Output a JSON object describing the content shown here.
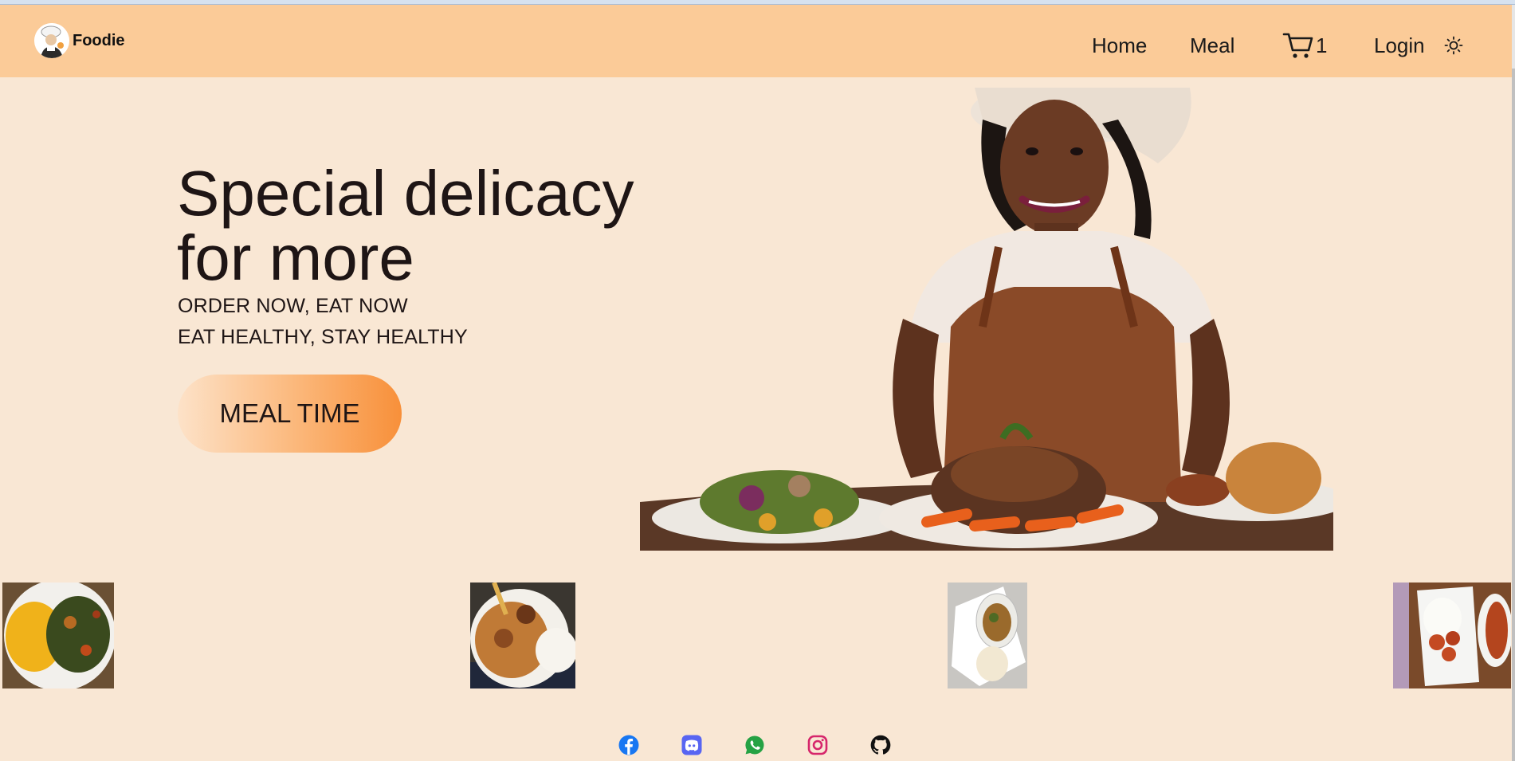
{
  "brand": {
    "name": "Foodie"
  },
  "nav": {
    "home": "Home",
    "meal": "Meal",
    "cart_count": "1",
    "login": "Login"
  },
  "hero": {
    "title": "Special delicacy for more",
    "tagline_1": "ORDER NOW, EAT NOW",
    "tagline_2": "EAT HEALTHY, STAY HEALTHY",
    "cta": "MEAL TIME"
  },
  "icons": {
    "cart": "cart-icon",
    "theme": "sun-icon",
    "socials": [
      "facebook-icon",
      "discord-icon",
      "whatsapp-icon",
      "instagram-icon",
      "github-icon"
    ]
  },
  "colors": {
    "navbar": "#fbcb98",
    "background": "#f9e7d4",
    "cta_end": "#f8903a",
    "facebook": "#1877f2",
    "discord": "#5865f2",
    "whatsapp": "#25a244",
    "instagram": "#d6266b",
    "github": "#111111"
  }
}
